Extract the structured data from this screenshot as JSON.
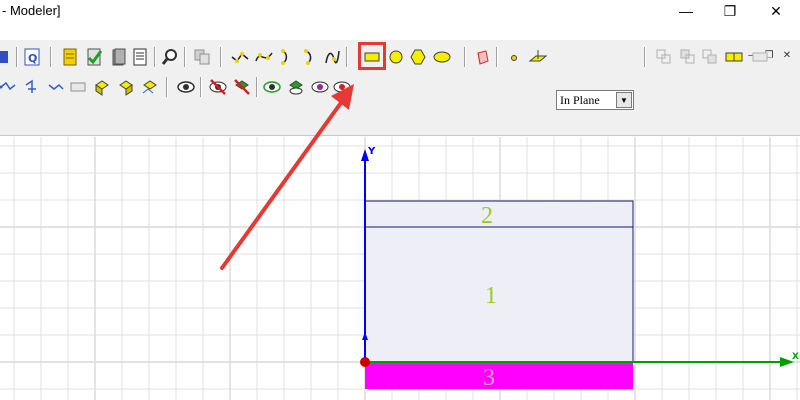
{
  "window": {
    "title": "- Modeler]",
    "minimize_glyph": "—",
    "maximize_glyph": "❐",
    "close_glyph": "✕"
  },
  "mdi": {
    "minimize_glyph": "–",
    "restore_glyph": "❐",
    "close_glyph": "✕"
  },
  "toolbar": {
    "plane_select": {
      "value": "In Plane"
    },
    "highlighted_tool": "rectangle-tool",
    "row1_icons": [
      "sheet-icon",
      "query-icon",
      "notes-icon",
      "check-icon",
      "stack-icon",
      "document-icon",
      "find-icon",
      "copy-icon",
      "line-icon",
      "spline-icon",
      "arc-icon",
      "arc-center-icon",
      "equation-curve-icon",
      "rectangle-icon",
      "circle-icon",
      "polygon-icon",
      "ellipse-icon",
      "box-icon",
      "point-icon",
      "plane-icon",
      "unite-icon",
      "subtract-icon",
      "intersect-icon",
      "split-icon",
      "sweep-icon"
    ],
    "row2_icons": [
      "move-icon",
      "rotate-icon",
      "mirror-icon",
      "scale-icon",
      "duplicate-icon",
      "duplicate-around-icon",
      "duplicate-mirror-icon",
      "eye-icon",
      "hide-icon",
      "hide-all-icon",
      "show-icon",
      "show-all-icon",
      "show-selected-icon",
      "fit-icon"
    ]
  },
  "canvas": {
    "axis_y_label": "Y",
    "axis_x_label": "X",
    "regions": [
      {
        "label": "2",
        "label_color": "#9ccc22"
      },
      {
        "label": "1",
        "label_color": "#9ccc22"
      },
      {
        "label": "3",
        "label_color": "#f6a8c8"
      }
    ],
    "colors": {
      "grid": "#d9d9d9",
      "region_fill": "#eeeef7",
      "region_stroke": "#1a1a6e",
      "magenta": "#ff00ff",
      "y_axis": "#0000ff",
      "x_axis": "#00a000",
      "origin": "#cc0000",
      "arrow": "#e53935"
    }
  }
}
